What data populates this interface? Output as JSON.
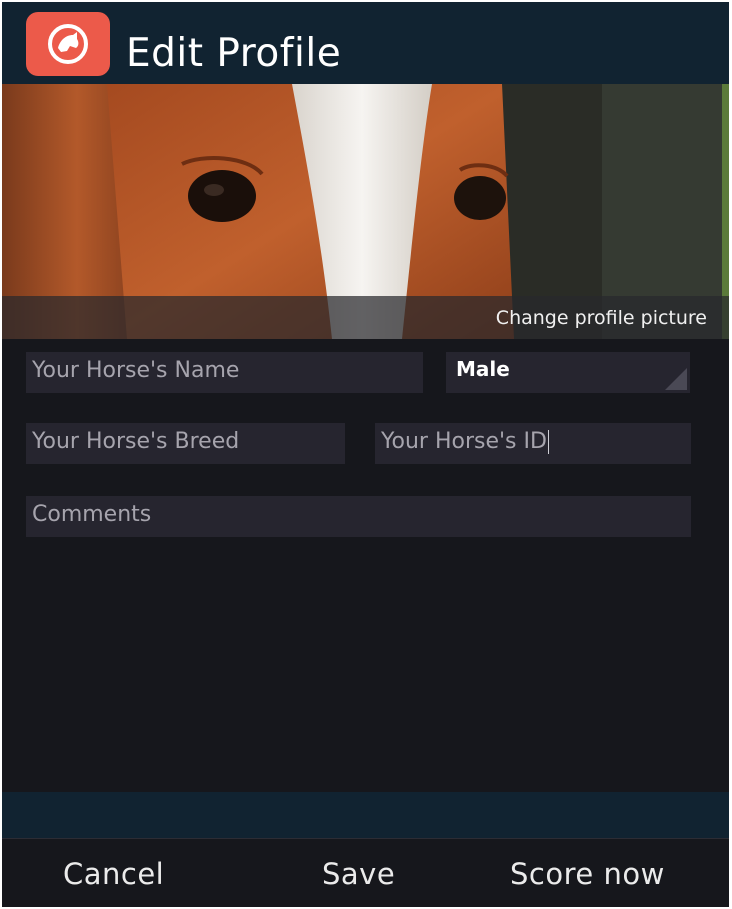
{
  "header": {
    "title": "Edit Profile",
    "app_icon": "horse-head-icon",
    "accent": "#ec5a4a"
  },
  "photo": {
    "change_label": "Change profile picture"
  },
  "form": {
    "name_placeholder": "Your Horse's Name",
    "gender_value": "Male",
    "breed_placeholder": "Your Horse's Breed",
    "id_placeholder": "Your Horse's ID",
    "comments_placeholder": "Comments"
  },
  "actions": {
    "cancel": "Cancel",
    "save": "Save",
    "score": "Score now"
  }
}
